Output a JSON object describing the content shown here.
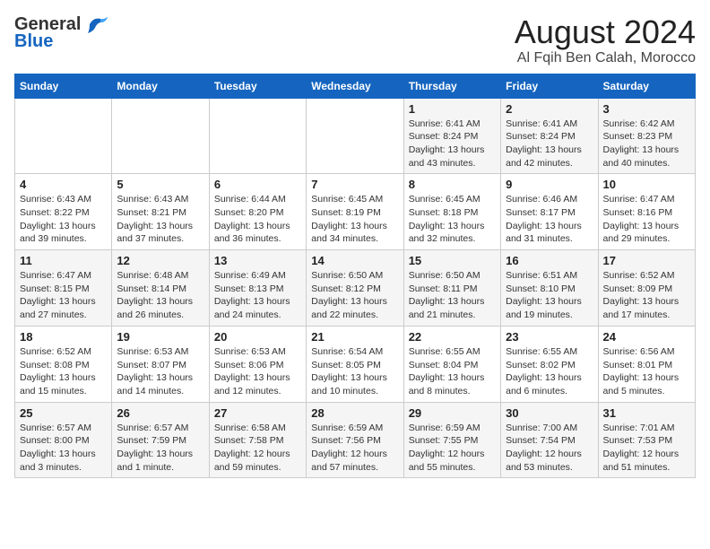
{
  "logo": {
    "general": "General",
    "blue": "Blue"
  },
  "title": "August 2024",
  "subtitle": "Al Fqih Ben Calah, Morocco",
  "days_of_week": [
    "Sunday",
    "Monday",
    "Tuesday",
    "Wednesday",
    "Thursday",
    "Friday",
    "Saturday"
  ],
  "weeks": [
    [
      {
        "day": "",
        "info": ""
      },
      {
        "day": "",
        "info": ""
      },
      {
        "day": "",
        "info": ""
      },
      {
        "day": "",
        "info": ""
      },
      {
        "day": "1",
        "info": "Sunrise: 6:41 AM\nSunset: 8:24 PM\nDaylight: 13 hours\nand 43 minutes."
      },
      {
        "day": "2",
        "info": "Sunrise: 6:41 AM\nSunset: 8:24 PM\nDaylight: 13 hours\nand 42 minutes."
      },
      {
        "day": "3",
        "info": "Sunrise: 6:42 AM\nSunset: 8:23 PM\nDaylight: 13 hours\nand 40 minutes."
      }
    ],
    [
      {
        "day": "4",
        "info": "Sunrise: 6:43 AM\nSunset: 8:22 PM\nDaylight: 13 hours\nand 39 minutes."
      },
      {
        "day": "5",
        "info": "Sunrise: 6:43 AM\nSunset: 8:21 PM\nDaylight: 13 hours\nand 37 minutes."
      },
      {
        "day": "6",
        "info": "Sunrise: 6:44 AM\nSunset: 8:20 PM\nDaylight: 13 hours\nand 36 minutes."
      },
      {
        "day": "7",
        "info": "Sunrise: 6:45 AM\nSunset: 8:19 PM\nDaylight: 13 hours\nand 34 minutes."
      },
      {
        "day": "8",
        "info": "Sunrise: 6:45 AM\nSunset: 8:18 PM\nDaylight: 13 hours\nand 32 minutes."
      },
      {
        "day": "9",
        "info": "Sunrise: 6:46 AM\nSunset: 8:17 PM\nDaylight: 13 hours\nand 31 minutes."
      },
      {
        "day": "10",
        "info": "Sunrise: 6:47 AM\nSunset: 8:16 PM\nDaylight: 13 hours\nand 29 minutes."
      }
    ],
    [
      {
        "day": "11",
        "info": "Sunrise: 6:47 AM\nSunset: 8:15 PM\nDaylight: 13 hours\nand 27 minutes."
      },
      {
        "day": "12",
        "info": "Sunrise: 6:48 AM\nSunset: 8:14 PM\nDaylight: 13 hours\nand 26 minutes."
      },
      {
        "day": "13",
        "info": "Sunrise: 6:49 AM\nSunset: 8:13 PM\nDaylight: 13 hours\nand 24 minutes."
      },
      {
        "day": "14",
        "info": "Sunrise: 6:50 AM\nSunset: 8:12 PM\nDaylight: 13 hours\nand 22 minutes."
      },
      {
        "day": "15",
        "info": "Sunrise: 6:50 AM\nSunset: 8:11 PM\nDaylight: 13 hours\nand 21 minutes."
      },
      {
        "day": "16",
        "info": "Sunrise: 6:51 AM\nSunset: 8:10 PM\nDaylight: 13 hours\nand 19 minutes."
      },
      {
        "day": "17",
        "info": "Sunrise: 6:52 AM\nSunset: 8:09 PM\nDaylight: 13 hours\nand 17 minutes."
      }
    ],
    [
      {
        "day": "18",
        "info": "Sunrise: 6:52 AM\nSunset: 8:08 PM\nDaylight: 13 hours\nand 15 minutes."
      },
      {
        "day": "19",
        "info": "Sunrise: 6:53 AM\nSunset: 8:07 PM\nDaylight: 13 hours\nand 14 minutes."
      },
      {
        "day": "20",
        "info": "Sunrise: 6:53 AM\nSunset: 8:06 PM\nDaylight: 13 hours\nand 12 minutes."
      },
      {
        "day": "21",
        "info": "Sunrise: 6:54 AM\nSunset: 8:05 PM\nDaylight: 13 hours\nand 10 minutes."
      },
      {
        "day": "22",
        "info": "Sunrise: 6:55 AM\nSunset: 8:04 PM\nDaylight: 13 hours\nand 8 minutes."
      },
      {
        "day": "23",
        "info": "Sunrise: 6:55 AM\nSunset: 8:02 PM\nDaylight: 13 hours\nand 6 minutes."
      },
      {
        "day": "24",
        "info": "Sunrise: 6:56 AM\nSunset: 8:01 PM\nDaylight: 13 hours\nand 5 minutes."
      }
    ],
    [
      {
        "day": "25",
        "info": "Sunrise: 6:57 AM\nSunset: 8:00 PM\nDaylight: 13 hours\nand 3 minutes."
      },
      {
        "day": "26",
        "info": "Sunrise: 6:57 AM\nSunset: 7:59 PM\nDaylight: 13 hours\nand 1 minute."
      },
      {
        "day": "27",
        "info": "Sunrise: 6:58 AM\nSunset: 7:58 PM\nDaylight: 12 hours\nand 59 minutes."
      },
      {
        "day": "28",
        "info": "Sunrise: 6:59 AM\nSunset: 7:56 PM\nDaylight: 12 hours\nand 57 minutes."
      },
      {
        "day": "29",
        "info": "Sunrise: 6:59 AM\nSunset: 7:55 PM\nDaylight: 12 hours\nand 55 minutes."
      },
      {
        "day": "30",
        "info": "Sunrise: 7:00 AM\nSunset: 7:54 PM\nDaylight: 12 hours\nand 53 minutes."
      },
      {
        "day": "31",
        "info": "Sunrise: 7:01 AM\nSunset: 7:53 PM\nDaylight: 12 hours\nand 51 minutes."
      }
    ]
  ]
}
